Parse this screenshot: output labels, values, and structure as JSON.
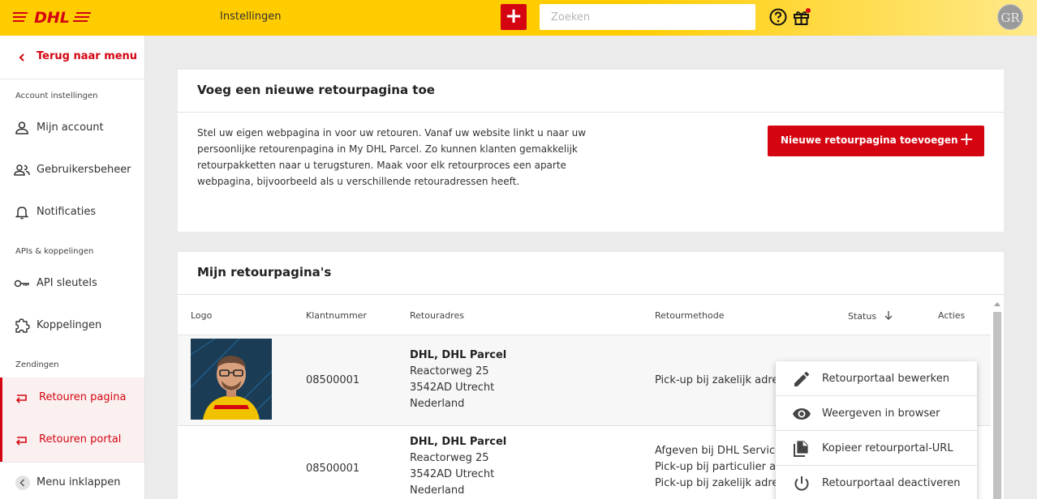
{
  "header": {
    "logo_text": "DHL",
    "settings_title": "Instellingen",
    "search_placeholder": "Zoeken",
    "avatar_initials": "GR"
  },
  "sidebar": {
    "back_label": "Terug naar menu",
    "sections": [
      {
        "label": "Account instellingen",
        "items": [
          {
            "label": "Mijn account",
            "icon": "user-icon"
          },
          {
            "label": "Gebruikersbeheer",
            "icon": "users-icon"
          },
          {
            "label": "Notificaties",
            "icon": "bell-icon"
          }
        ]
      },
      {
        "label": "APIs & koppelingen",
        "items": [
          {
            "label": "API sleutels",
            "icon": "key-icon"
          },
          {
            "label": "Koppelingen",
            "icon": "puzzle-icon"
          }
        ]
      },
      {
        "label": "Zendingen",
        "items": [
          {
            "label": "Retouren pagina",
            "icon": "return-icon",
            "active": true
          },
          {
            "label": "Retouren portal",
            "icon": "return-icon",
            "active": true
          }
        ]
      }
    ],
    "collapse_label": "Menu inklappen"
  },
  "add_card": {
    "title": "Voeg een nieuwe retourpagina toe",
    "description": "Stel uw eigen webpagina in voor uw retouren. Vanaf uw website linkt u naar uw persoonlijke retourenpagina in My DHL Parcel. Zo kunnen klanten gemakkelijk retourpakketten naar u terugsturen. Maak voor elk retourproces een aparte webpagina, bijvoorbeeld als u verschillende retouradressen heeft.",
    "button_label": "Nieuwe retourpagina toevoegen",
    "button_plus": "+"
  },
  "list_card": {
    "title": "Mijn retourpagina's",
    "columns": [
      "Logo",
      "Klantnummer",
      "Retouradres",
      "Retourmethode",
      "Status",
      "Acties"
    ],
    "rows": [
      {
        "klantnummer": "08500001",
        "address": [
          "DHL, DHL Parcel",
          "Reactorweg 25",
          "3542AD Utrecht",
          "Nederland"
        ],
        "methods": [
          "Pick-up bij zakelijk adres"
        ]
      },
      {
        "klantnummer": "08500001",
        "address": [
          "DHL, DHL Parcel",
          "Reactorweg 25",
          "3542AD Utrecht",
          "Nederland"
        ],
        "methods": [
          "Afgeven bij DHL Service",
          "Pick-up bij particulier ad",
          "Pick-up bij zakelijk adres"
        ]
      }
    ]
  },
  "actions_menu": [
    {
      "label": "Retourportaal bewerken",
      "icon": "pencil-icon"
    },
    {
      "label": "Weergeven in browser",
      "icon": "eye-icon"
    },
    {
      "label": "Kopieer retourportal-URL",
      "icon": "copy-icon"
    },
    {
      "label": "Retourportaal deactiveren",
      "icon": "power-icon"
    }
  ],
  "colors": {
    "brand_red": "#d40511",
    "brand_yellow": "#ffcc00"
  }
}
